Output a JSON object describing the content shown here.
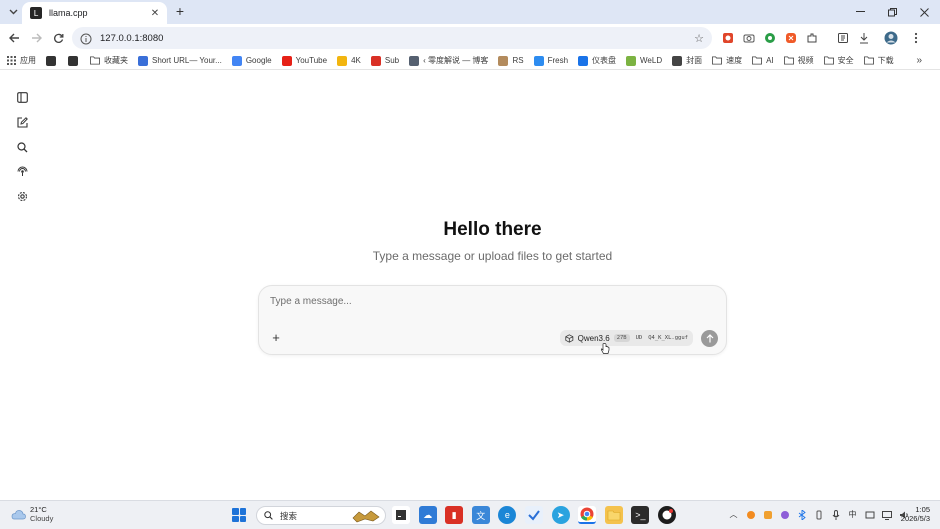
{
  "browser": {
    "tab": {
      "title": "llama.cpp",
      "favicon_text": "L"
    },
    "url": "127.0.0.1:8080",
    "bookmarks": [
      {
        "label": "应用",
        "icon": "apps-grid-icon",
        "color": "#4a4a4a"
      },
      {
        "label": "",
        "icon": "dark-square-icon",
        "color": "#333333"
      },
      {
        "label": "",
        "icon": "qr-icon",
        "color": "#333333"
      },
      {
        "label": "收藏夹",
        "icon": "folder-icon",
        "color": "#ffffff"
      },
      {
        "label": "Short URL— Your...",
        "icon": "link-icon",
        "color": "#3a6fd8"
      },
      {
        "label": "Google",
        "icon": "google-icon",
        "color": "#4285f4"
      },
      {
        "label": "YouTube",
        "icon": "youtube-icon",
        "color": "#e62117"
      },
      {
        "label": "4K",
        "icon": "4k-icon",
        "color": "#f2b50f"
      },
      {
        "label": "Sub",
        "icon": "sub-icon",
        "color": "#d93025"
      },
      {
        "label": "‹ 零度解说 — 博客",
        "icon": "avatar-icon",
        "color": "#556070"
      },
      {
        "label": "RS",
        "icon": "rs-icon",
        "color": "#b38b5d"
      },
      {
        "label": "Fresh",
        "icon": "fresh-icon",
        "color": "#2d8cf0"
      },
      {
        "label": "仪表盘",
        "icon": "shield-icon",
        "color": "#1a73e8"
      },
      {
        "label": "WeLD",
        "icon": "weld-icon",
        "color": "#7cb342"
      },
      {
        "label": "封面",
        "icon": "globe-icon",
        "color": "#444444"
      },
      {
        "label": "速度",
        "icon": "folder-icon",
        "color": "#ffffff"
      },
      {
        "label": "AI",
        "icon": "folder-icon",
        "color": "#ffffff"
      },
      {
        "label": "视频",
        "icon": "folder-icon",
        "color": "#ffffff"
      },
      {
        "label": "安全",
        "icon": "folder-icon",
        "color": "#ffffff"
      },
      {
        "label": "下载",
        "icon": "folder-icon",
        "color": "#ffffff"
      }
    ],
    "more_bookmarks": "»"
  },
  "app": {
    "title": "Hello there",
    "subtitle": "Type a message or upload files to get started",
    "input_placeholder": "Type a message...",
    "model": {
      "name": "Qwen3.6",
      "tag": "27B",
      "variant": "UD",
      "file": "Q4_K_XL.gguf"
    }
  },
  "taskbar": {
    "weather_temp": "21°C",
    "weather_cond": "Cloudy",
    "search_placeholder": "搜索",
    "ime": "中",
    "time": "1:05",
    "date": "2026/5/3"
  }
}
